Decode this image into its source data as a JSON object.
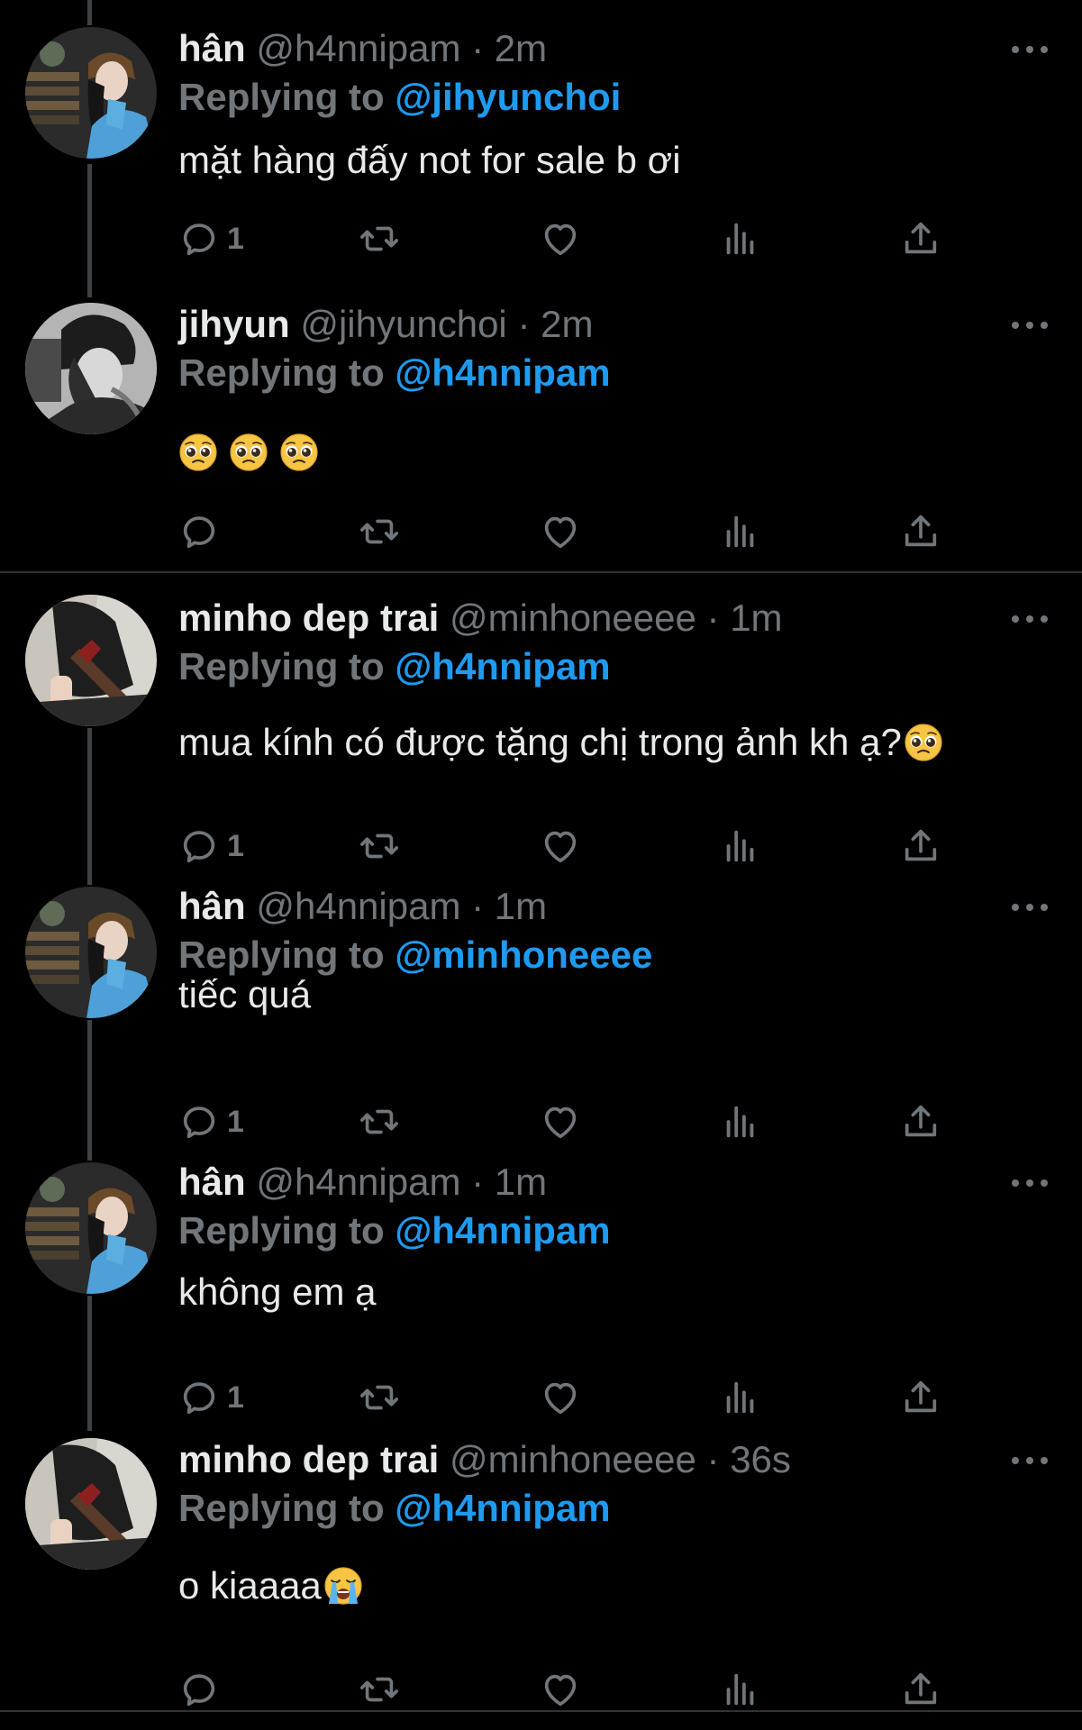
{
  "replying_label": "Replying to",
  "dot": "·",
  "colors": {
    "background": "#000000",
    "text": "#e7e9ea",
    "muted": "#71767b",
    "link": "#1d9bf0",
    "divider": "#2f3336"
  },
  "icons": [
    "reply-icon",
    "retweet-icon",
    "like-icon",
    "views-icon",
    "share-icon",
    "more-icon",
    "pleading-face-emoji",
    "crying-face-emoji"
  ],
  "tweets": [
    {
      "name": "hân",
      "handle": "@h4nnipam",
      "time": "2m",
      "replying_to": "@jihyunchoi",
      "text": "mặt hàng đấy not for sale b ơi",
      "reply_count": "1"
    },
    {
      "name": "jihyun",
      "handle": "@jihyunchoi",
      "time": "2m",
      "replying_to": "@h4nnipam",
      "text": "",
      "reply_count": ""
    },
    {
      "name": "minho dep trai",
      "handle": "@minhoneeee",
      "time": "1m",
      "replying_to": "@h4nnipam",
      "text": "mua kính có được tặng chị trong ảnh kh ạ?",
      "reply_count": "1"
    },
    {
      "name": "hân",
      "handle": "@h4nnipam",
      "time": "1m",
      "replying_to": "@minhoneeee",
      "text": "tiếc quá",
      "reply_count": "1"
    },
    {
      "name": "hân",
      "handle": "@h4nnipam",
      "time": "1m",
      "replying_to": "@h4nnipam",
      "text": "không em ạ",
      "reply_count": "1"
    },
    {
      "name": "minho dep trai",
      "handle": "@minhoneeee",
      "time": "36s",
      "replying_to": "@h4nnipam",
      "text": "o kiaaaa",
      "reply_count": ""
    }
  ]
}
